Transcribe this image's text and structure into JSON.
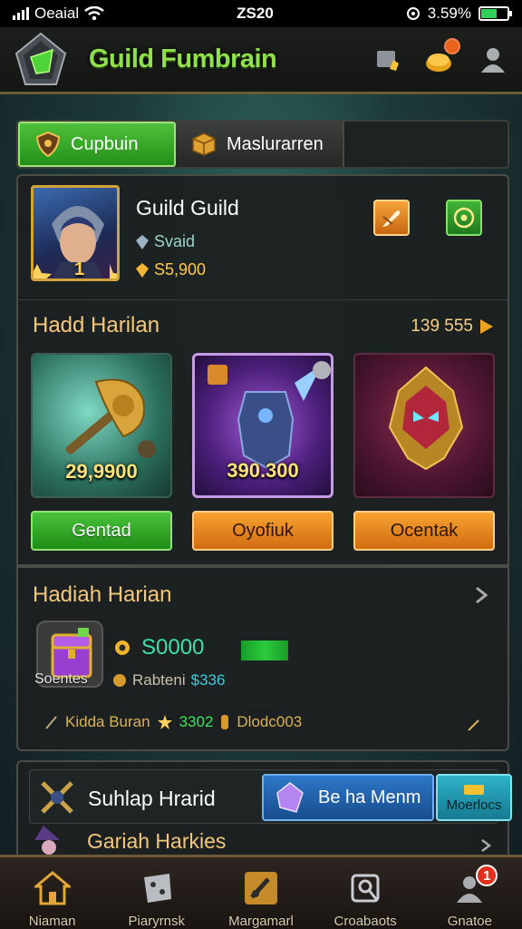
{
  "status_bar": {
    "carrier": "Oeaial",
    "time": "ZS20",
    "battery": "3.59%",
    "battery_level": 0.59
  },
  "header": {
    "title": "Guild Fumbrain",
    "notification_badge": ""
  },
  "tabs": [
    {
      "label": "Cupbuin",
      "active": true
    },
    {
      "label": "Maslurarren",
      "active": false
    }
  ],
  "profile": {
    "name": "Guild Guild",
    "subtitle": "Svaid",
    "gold": "S5,900",
    "rank": "1"
  },
  "daily": {
    "title": "Hadd Harilan",
    "right_value": "139 555",
    "items": [
      {
        "value": "29,9900",
        "button": "Gentad",
        "button_style": "green"
      },
      {
        "value": "390.300",
        "button": "Oyofiuk",
        "button_style": "orange"
      },
      {
        "value": "",
        "button": "Ocentak",
        "button_style": "orange"
      }
    ]
  },
  "hadiah": {
    "title": "Hadiah Harian",
    "chest_label": "Soentes",
    "amount": "S0000",
    "sub_label": "Rabteni",
    "sub_value": "$336",
    "footer_text": "Kidda Buran",
    "footer_green": "3302",
    "footer_code": "Dlodc003"
  },
  "lower": {
    "title": "Suhlap Hrarid",
    "member_button": "Be ha Menm",
    "teal_button": "Moerlocs",
    "subtitle": "Gariah Harkies"
  },
  "bottom_nav": [
    {
      "label": "Niaman",
      "icon": "home-icon"
    },
    {
      "label": "Piaryrnsk",
      "icon": "dice-icon"
    },
    {
      "label": "Margamarl",
      "icon": "sword-icon"
    },
    {
      "label": "Croabaots",
      "icon": "search-icon"
    },
    {
      "label": "Gnatoe",
      "icon": "users-icon",
      "badge": "1"
    }
  ],
  "colors": {
    "accent_green": "#8fe04b",
    "gold": "#ffca4a",
    "orange": "#f9a232",
    "panel": "#1c2020"
  }
}
